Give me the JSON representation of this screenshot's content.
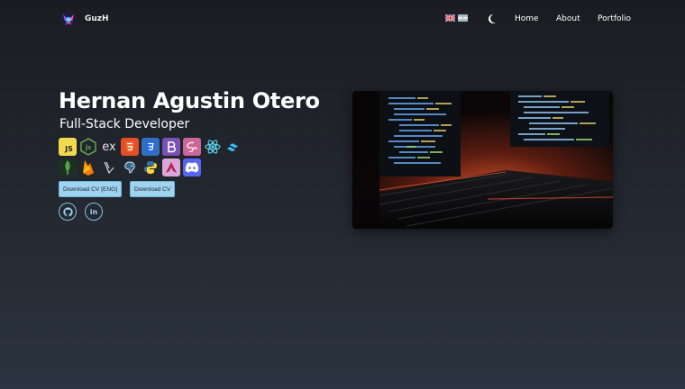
{
  "brand": {
    "name": "GuzH",
    "logo_icon": "space-invader-logo-icon"
  },
  "nav": {
    "flags": [
      {
        "name": "uk-flag-icon",
        "lang": "English"
      },
      {
        "name": "argentina-flag-icon",
        "lang": "Spanish"
      }
    ],
    "theme_icon": "moon-icon",
    "links": [
      {
        "label": "Home"
      },
      {
        "label": "About"
      },
      {
        "label": "Portfolio"
      }
    ]
  },
  "hero": {
    "title": "Hernan Agustin Otero",
    "subtitle": "Full-Stack Developer",
    "tech_icons_row1": [
      "javascript-icon",
      "nodejs-icon",
      "express-icon",
      "html5-icon",
      "css3-icon",
      "bootstrap-icon",
      "sass-icon",
      "react-icon",
      "tailwind-icon"
    ],
    "tech_icons_row2": [
      "mongodb-icon",
      "firebase-icon",
      "sequelize-icon",
      "postgresql-icon",
      "python-icon",
      "arch-icon",
      "discord-icon"
    ],
    "tech_text": {
      "js": "JS",
      "express": "ex"
    },
    "buttons": [
      {
        "label": "Download CV [ENG]"
      },
      {
        "label": "Download CV"
      }
    ],
    "social": [
      {
        "icon": "github-icon"
      },
      {
        "icon": "linkedin-icon",
        "text": "in"
      }
    ],
    "image_alt": "laptop-keyboard-code-photo"
  },
  "colors": {
    "accent": "#9fd3ee",
    "background_top": "#1b1c21",
    "background_bottom": "#2b3440"
  }
}
